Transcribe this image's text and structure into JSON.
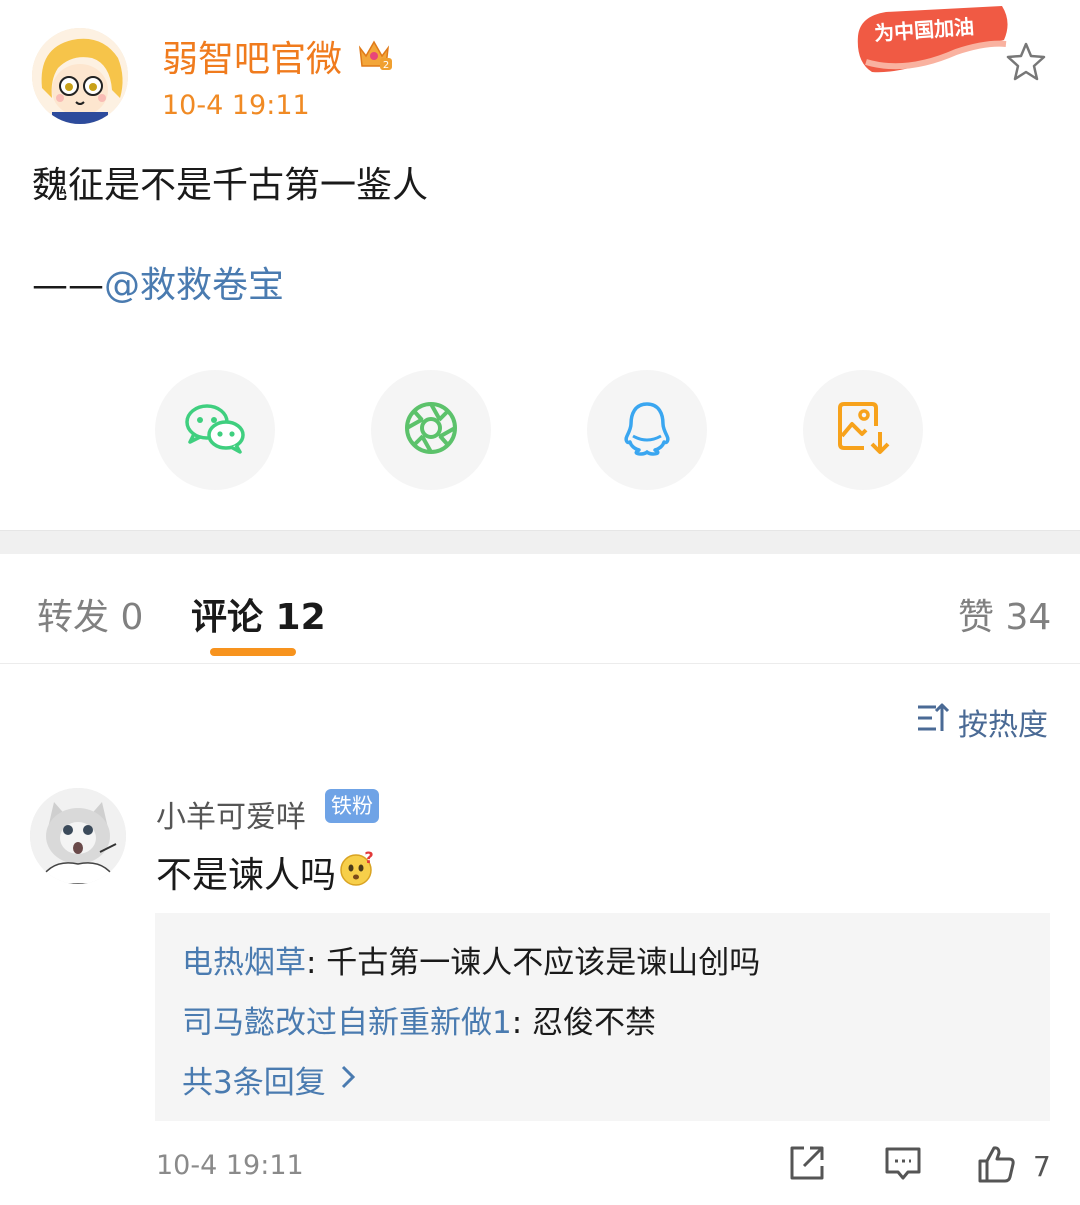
{
  "post": {
    "username": "弱智吧官微",
    "time": "10-4 19:11",
    "badge_text": "为中国加油",
    "text": "魏征是不是千古第一鉴人",
    "credit_dash": "——",
    "credit_mention": "@救救卷宝"
  },
  "share": [
    {
      "name": "wechat",
      "icon": "wechat-icon",
      "color": "#3fcf7f"
    },
    {
      "name": "moments",
      "icon": "moments-icon",
      "color": "#5cc26b"
    },
    {
      "name": "qq",
      "icon": "qq-icon",
      "color": "#3aa6f0"
    },
    {
      "name": "save-image",
      "icon": "save-image-icon",
      "color": "#f7a21b"
    }
  ],
  "tabs": {
    "repost": "转发 0",
    "comments": "评论 12",
    "likes": "赞 34"
  },
  "sort_label": "按热度",
  "comment": {
    "name": "小羊可爱咩",
    "fan_badge": "铁粉",
    "text": "不是谏人吗",
    "replies": [
      {
        "who": "电热烟草",
        "what": ": 千古第一谏人不应该是谏山创吗"
      },
      {
        "who": "司马懿改过自新重新做1",
        "what": ": 忍俊不禁"
      }
    ],
    "more_replies": "共3条回复",
    "time": "10-4 19:11",
    "like_count": "7"
  },
  "colors": {
    "accent": "#f7931e",
    "username": "#f07b1d",
    "link": "#4a7bb0"
  }
}
